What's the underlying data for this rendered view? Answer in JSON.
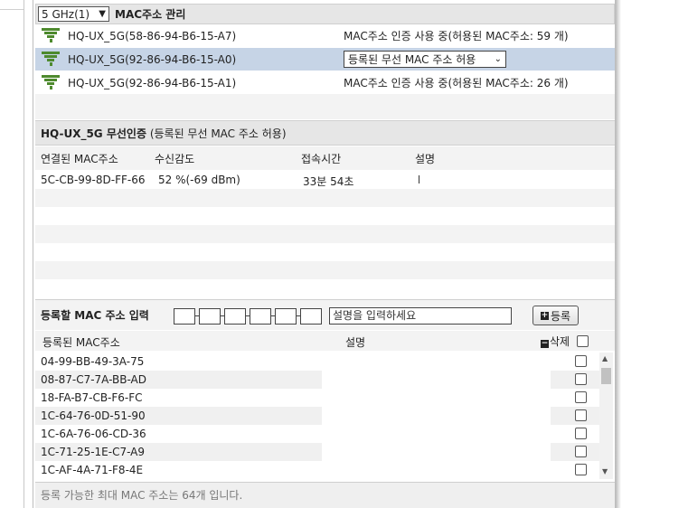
{
  "header": {
    "band_selected": "5 GHz(1)",
    "title": "MAC주소 관리"
  },
  "ssids": [
    {
      "name": "HQ-UX_5G(58-86-94-B6-15-A7)",
      "status": "MAC주소 인증 사용 중(허용된 MAC주소: 59 개)"
    },
    {
      "name": "HQ-UX_5G(92-86-94-B6-15-A0)",
      "policy_selected": "등록된 무선 MAC 주소 허용"
    },
    {
      "name": "HQ-UX_5G(92-86-94-B6-15-A1)",
      "status": "MAC주소 인증 사용 중(허용된 MAC주소: 26 개)"
    }
  ],
  "auth": {
    "ssid": "HQ-UX_5G 무선인증",
    "mode": "(등록된 무선 MAC 주소 허용)"
  },
  "connected": {
    "columns": {
      "mac": "연결된 MAC주소",
      "signal": "수신감도",
      "time": "접속시간",
      "desc": "설명"
    },
    "rows": [
      {
        "mac": "5C-CB-99-8D-FF-66",
        "signal": "52 %(-69 dBm)",
        "time": "33분 54초",
        "desc": ""
      }
    ]
  },
  "register": {
    "label": "등록할 MAC 주소 입력",
    "desc_placeholder": "설명을 입력하세요",
    "button_label": "등록"
  },
  "registered": {
    "columns": {
      "mac": "등록된 MAC주소",
      "desc": "설명",
      "delete": "삭제"
    },
    "rows": [
      {
        "mac": "04-99-BB-49-3A-75"
      },
      {
        "mac": "08-87-C7-7A-BB-AD"
      },
      {
        "mac": "18-FA-B7-CB-F6-FC"
      },
      {
        "mac": "1C-64-76-0D-51-90"
      },
      {
        "mac": "1C-6A-76-06-CD-36"
      },
      {
        "mac": "1C-71-25-1E-C7-A9"
      },
      {
        "mac": "1C-AF-4A-71-F8-4E"
      }
    ]
  },
  "footer": {
    "text": "등록 가능한 최대 MAC 주소는 64개 입니다."
  }
}
